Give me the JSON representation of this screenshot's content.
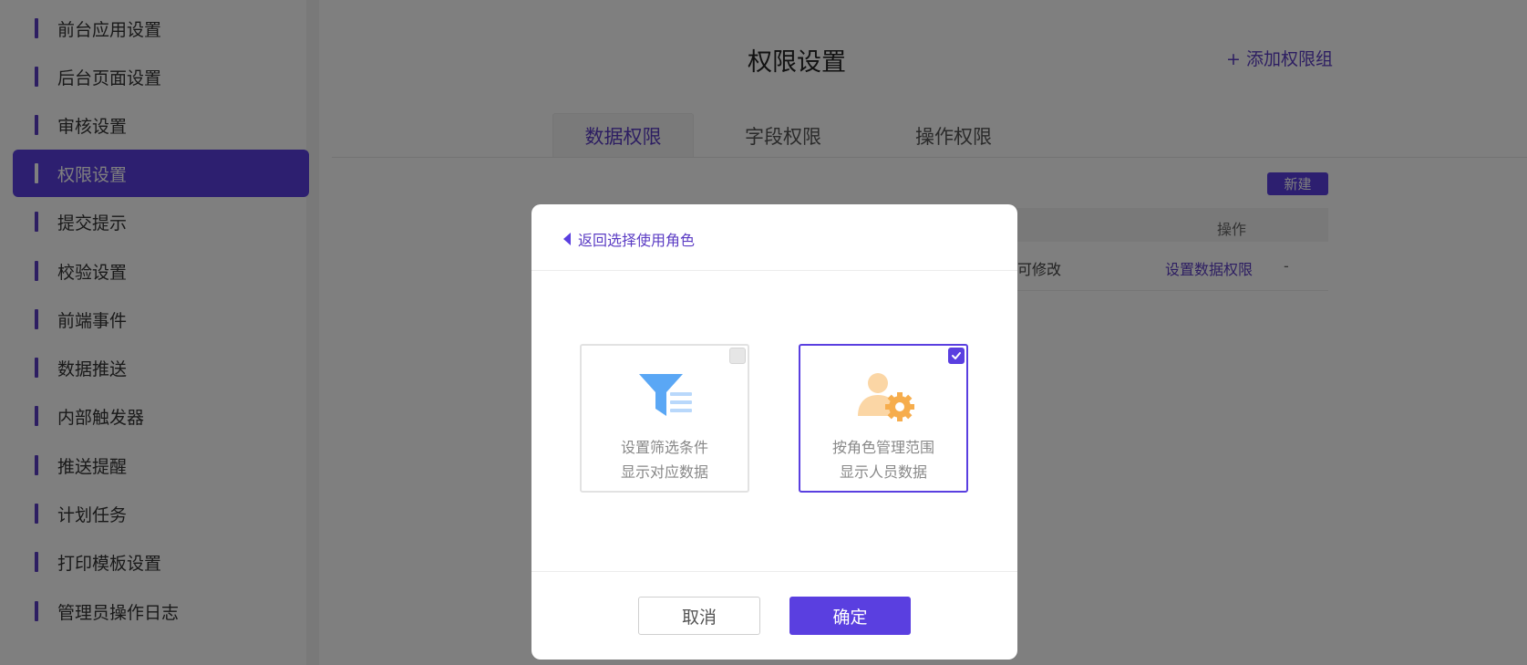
{
  "sidebar": {
    "items": [
      {
        "label": "前台应用设置"
      },
      {
        "label": "后台页面设置"
      },
      {
        "label": "审核设置"
      },
      {
        "label": "权限设置"
      },
      {
        "label": "提交提示"
      },
      {
        "label": "校验设置"
      },
      {
        "label": "前端事件"
      },
      {
        "label": "数据推送"
      },
      {
        "label": "内部触发器"
      },
      {
        "label": "推送提醒"
      },
      {
        "label": "计划任务"
      },
      {
        "label": "打印模板设置"
      },
      {
        "label": "管理员操作日志"
      }
    ],
    "active_index": 3
  },
  "main": {
    "title": "权限设置",
    "add_group": "+ 添加权限组",
    "tabs": [
      {
        "label": "数据权限"
      },
      {
        "label": "字段权限"
      },
      {
        "label": "操作权限"
      }
    ],
    "new_button": "新建",
    "table": {
      "header_operation": "操作",
      "row": {
        "text": "可修改",
        "link": "设置数据权限",
        "dash": "-"
      }
    }
  },
  "modal": {
    "back": "返回选择使用角色",
    "options": [
      {
        "line1": "设置筛选条件",
        "line2": "显示对应数据",
        "checked": false,
        "icon": "funnel-filter-icon"
      },
      {
        "line1": "按角色管理范围",
        "line2": "显示人员数据",
        "checked": true,
        "icon": "user-gear-icon"
      }
    ],
    "cancel": "取消",
    "confirm": "确定"
  },
  "colors": {
    "accent": "#5a3fe0",
    "funnel": "#5aa7f5",
    "user": "#f6ad4d"
  }
}
